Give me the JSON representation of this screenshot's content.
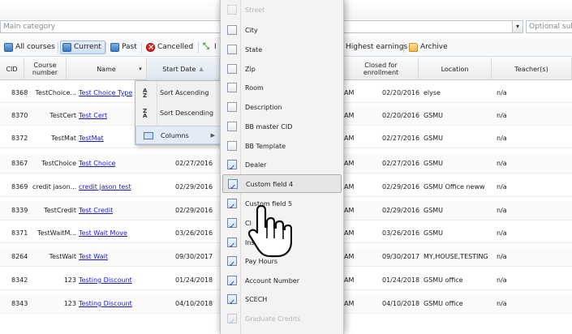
{
  "filters": {
    "category_placeholder": "Main category",
    "optional_placeholder": "Optional sul"
  },
  "toolbar": {
    "all_courses": "All courses",
    "current": "Current",
    "past": "Past",
    "cancelled": "Cancelled",
    "partial_label": "I",
    "highest_earnings": "Highest earnings",
    "archive": "Archive"
  },
  "columns": {
    "cid": "CID",
    "course_number_line1": "Course",
    "course_number_line2": "number",
    "name": "Name",
    "start_date": "Start Date",
    "closed_line1": "Closed for",
    "closed_line2": "enrollment",
    "location": "Location",
    "teachers": "Teacher(s)"
  },
  "rows": [
    {
      "cid": "8368",
      "num": "TestChoice...",
      "name": "Test Choice Type",
      "start": "",
      "partial": "AM",
      "closed": "02/20/2016",
      "location": "elyse",
      "teacher": "n/a"
    },
    {
      "cid": "8370",
      "num": "TestCert",
      "name": "Test Cert",
      "start": "",
      "partial": "AM",
      "closed": "02/20/2016",
      "location": "GSMU",
      "teacher": "n/a"
    },
    {
      "cid": "8372",
      "num": "TestMat",
      "name": "TestMat",
      "start": "",
      "partial": "AM",
      "closed": "02/27/2016",
      "location": "GSMU",
      "teacher": "n/a"
    },
    {
      "cid": "8367",
      "num": "TestChoice",
      "name": "Test Choice",
      "start": "02/27/2016",
      "partial": "AM",
      "closed": "02/27/2016",
      "location": "GSMU",
      "teacher": "n/a"
    },
    {
      "cid": "8369",
      "num": "credit jason...",
      "name": "credit jason test",
      "start": "02/29/2016",
      "partial": "AM",
      "closed": "02/29/2016",
      "location": "GSMU Office neww",
      "teacher": "n/a"
    },
    {
      "cid": "8339",
      "num": "TestCredit",
      "name": "Test Credit",
      "start": "02/29/2016",
      "partial": "AM",
      "closed": "02/29/2016",
      "location": "GSMU",
      "teacher": "n/a"
    },
    {
      "cid": "8371",
      "num": "TestWaitM...",
      "name": "Test Wait Move",
      "start": "03/26/2016",
      "partial": "AM",
      "closed": "03/26/2016",
      "location": "GSMU",
      "teacher": "n/a"
    },
    {
      "cid": "8264",
      "num": "TestWait",
      "name": "Test Wait",
      "start": "09/30/2017",
      "partial": "AM",
      "closed": "09/30/2017",
      "location": "MY,HOUSE,TESTING",
      "teacher": "n/a"
    },
    {
      "cid": "8342",
      "num": "123",
      "name": "Testing Discount",
      "start": "01/24/2018",
      "partial": "AM",
      "closed": "01/24/2018",
      "location": "GSMU office",
      "teacher": "n/a"
    },
    {
      "cid": "8343",
      "num": "123",
      "name": "Testing Discount",
      "start": "04/10/2018",
      "partial": "AM",
      "closed": "04/10/2018",
      "location": "GSMU office",
      "teacher": "n/a"
    }
  ],
  "column_menu": {
    "sort_asc": "Sort Ascending",
    "sort_desc": "Sort Descending",
    "columns": "Columns",
    "sort_asc_icon": "sort-ascending-icon",
    "sort_desc_icon": "sort-descending-icon",
    "columns_icon": "columns-icon"
  },
  "column_chooser": [
    {
      "label": "Street",
      "checked": false
    },
    {
      "label": "City",
      "checked": false
    },
    {
      "label": "State",
      "checked": false
    },
    {
      "label": "Zip",
      "checked": false
    },
    {
      "label": "Room",
      "checked": false
    },
    {
      "label": "Description",
      "checked": false
    },
    {
      "label": "BB master CID",
      "checked": false
    },
    {
      "label": "BB Template",
      "checked": false
    },
    {
      "label": "Dealer",
      "checked": true
    },
    {
      "label": "Custom field 4",
      "checked": true
    },
    {
      "label": "Custom field 5",
      "checked": true
    },
    {
      "label": "Cl",
      "checked": true
    },
    {
      "label": "Inst",
      "checked": true
    },
    {
      "label": "Pay Hours",
      "checked": true
    },
    {
      "label": "Account Number",
      "checked": true
    },
    {
      "label": "SCECH",
      "checked": true
    },
    {
      "label": "Graduate Credits",
      "checked": true
    }
  ]
}
